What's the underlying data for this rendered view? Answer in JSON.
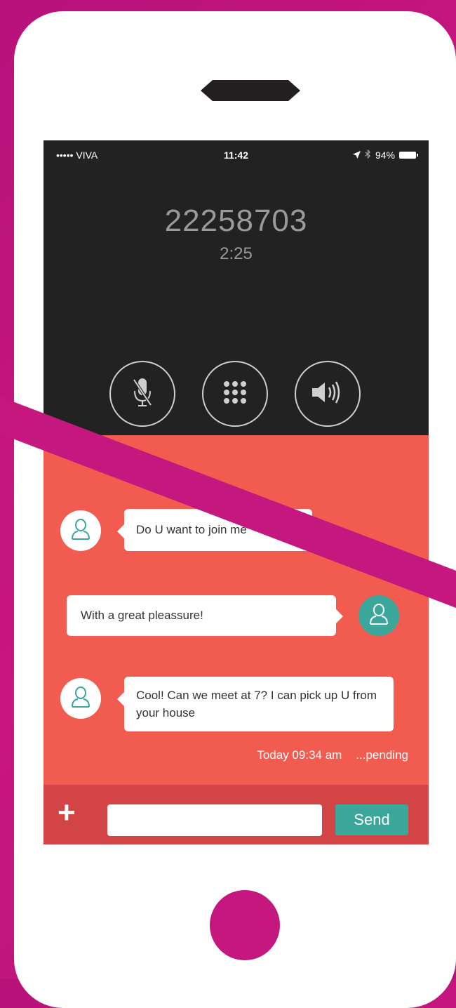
{
  "status_bar": {
    "carrier": "••••• VIVA",
    "time": "11:42",
    "battery": "94%",
    "location_icon": "location-arrow-icon",
    "bluetooth_icon": "bluetooth-icon"
  },
  "call": {
    "number": "22258703",
    "duration": "2:25",
    "buttons": [
      {
        "icon": "mute-icon"
      },
      {
        "icon": "keypad-icon"
      },
      {
        "icon": "speaker-icon"
      },
      {
        "icon": "contacts-icon"
      }
    ]
  },
  "chat": {
    "messages": [
      {
        "text": "Do U want to join me",
        "side": "left"
      },
      {
        "text": "With a great pleassure!",
        "side": "right"
      },
      {
        "text": "Cool! Can we meet at 7? I can pick up U from your house",
        "side": "left"
      }
    ],
    "timestamp": "Today 09:34 am",
    "status": "...pending"
  },
  "composer": {
    "plus_label": "+",
    "input_value": "",
    "send_label": "Send"
  },
  "colors": {
    "background": "#c4187f",
    "chat_bg": "#f25c50",
    "input_bar": "#d24445",
    "accent_teal": "#3aa79a",
    "call_screen": "#222222"
  }
}
